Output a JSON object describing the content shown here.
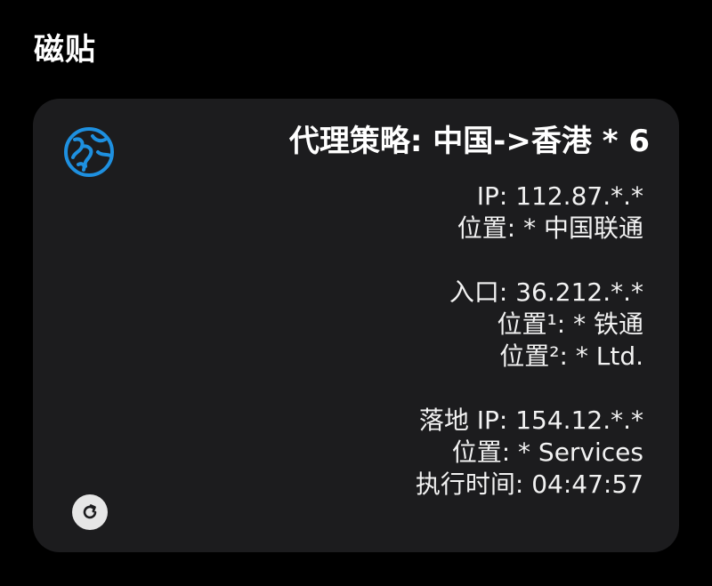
{
  "section": {
    "title": "磁贴"
  },
  "tile": {
    "title": "代理策略: 中国->香港 * 6",
    "accent_color": "#1e90e0",
    "icon": "globe-icon",
    "refresh_icon": "refresh-icon",
    "lines": {
      "ip": "IP: 112.87.*.*",
      "ip_location": "位置: * 中国联通",
      "entry": "入口: 36.212.*.*",
      "entry_location_1": "位置¹: * 铁通",
      "entry_location_2": "位置²: * Ltd.",
      "exit_ip": "落地 IP: 154.12.*.*",
      "exit_location": "位置: * Services",
      "exec_time": "执行时间: 04:47:57"
    }
  }
}
